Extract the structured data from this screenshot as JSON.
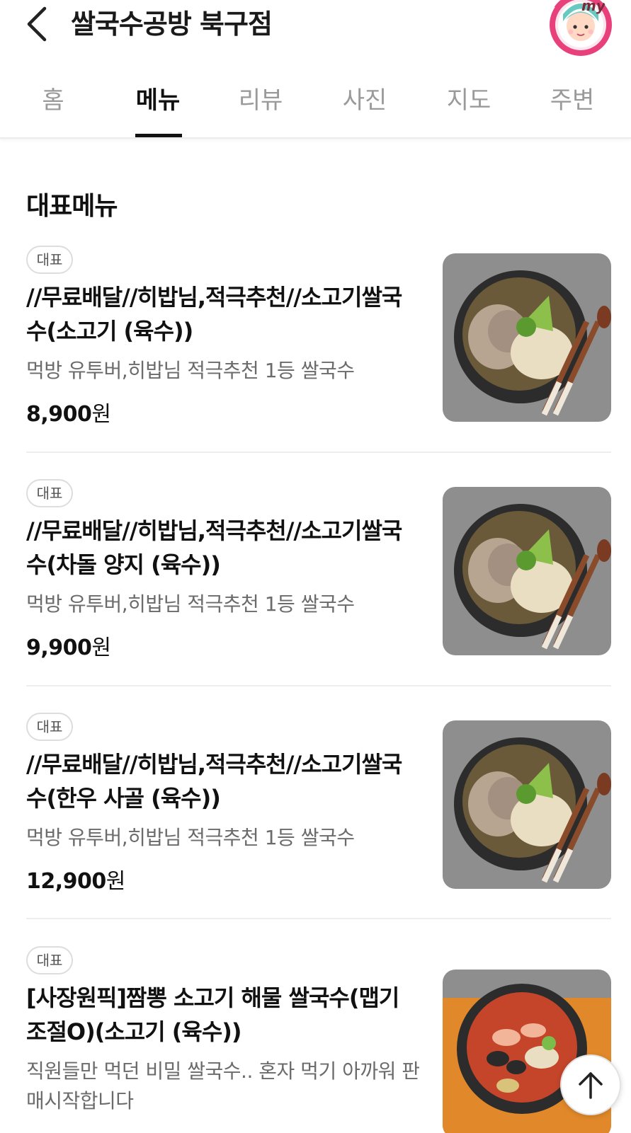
{
  "header": {
    "title": "쌀국수공방 북구점",
    "back_icon": "chevron-left-icon",
    "avatar_icon": "my-profile-avatar-icon",
    "avatar_label": "my"
  },
  "tabs": [
    {
      "label": "홈",
      "active": false
    },
    {
      "label": "메뉴",
      "active": true
    },
    {
      "label": "리뷰",
      "active": false
    },
    {
      "label": "사진",
      "active": false
    },
    {
      "label": "지도",
      "active": false
    },
    {
      "label": "주변",
      "active": false
    }
  ],
  "section": {
    "title": "대표메뉴"
  },
  "menu_items": [
    {
      "badge": "대표",
      "name": "//무료배달//히밥님,적극추천//소고기쌀국수(소고기 (육수))",
      "description": "먹방 유투버,히밥님 적극추천 1등 쌀국수",
      "price": "8,900",
      "currency": "원",
      "image": "beef-pho-bowl-image"
    },
    {
      "badge": "대표",
      "name": "//무료배달//히밥님,적극추천//소고기쌀국수(차돌 양지 (육수))",
      "description": "먹방 유투버,히밥님 적극추천 1등 쌀국수",
      "price": "9,900",
      "currency": "원",
      "image": "beef-pho-bowl-image"
    },
    {
      "badge": "대표",
      "name": "//무료배달//히밥님,적극추천//소고기쌀국수(한우 사골 (육수))",
      "description": "먹방 유투버,히밥님 적극추천 1등 쌀국수",
      "price": "12,900",
      "currency": "원",
      "image": "beef-pho-bowl-image"
    },
    {
      "badge": "대표",
      "name": "[사장원픽]짬뽕 소고기 해물 쌀국수(맵기조절O)(소고기 (육수))",
      "description": "직원들만 먹던 비밀 쌀국수.. 혼자 먹기 아까워 판매시작합니다",
      "image": "spicy-seafood-pho-image"
    }
  ],
  "scroll_top": {
    "icon": "arrow-up-icon"
  },
  "colors": {
    "text_primary": "#111111",
    "text_secondary": "#6b6b6b",
    "tab_inactive": "#9a9a9a",
    "badge_border": "#dddddd",
    "divider": "#eeeeee",
    "avatar_ring": "#e8407a"
  }
}
